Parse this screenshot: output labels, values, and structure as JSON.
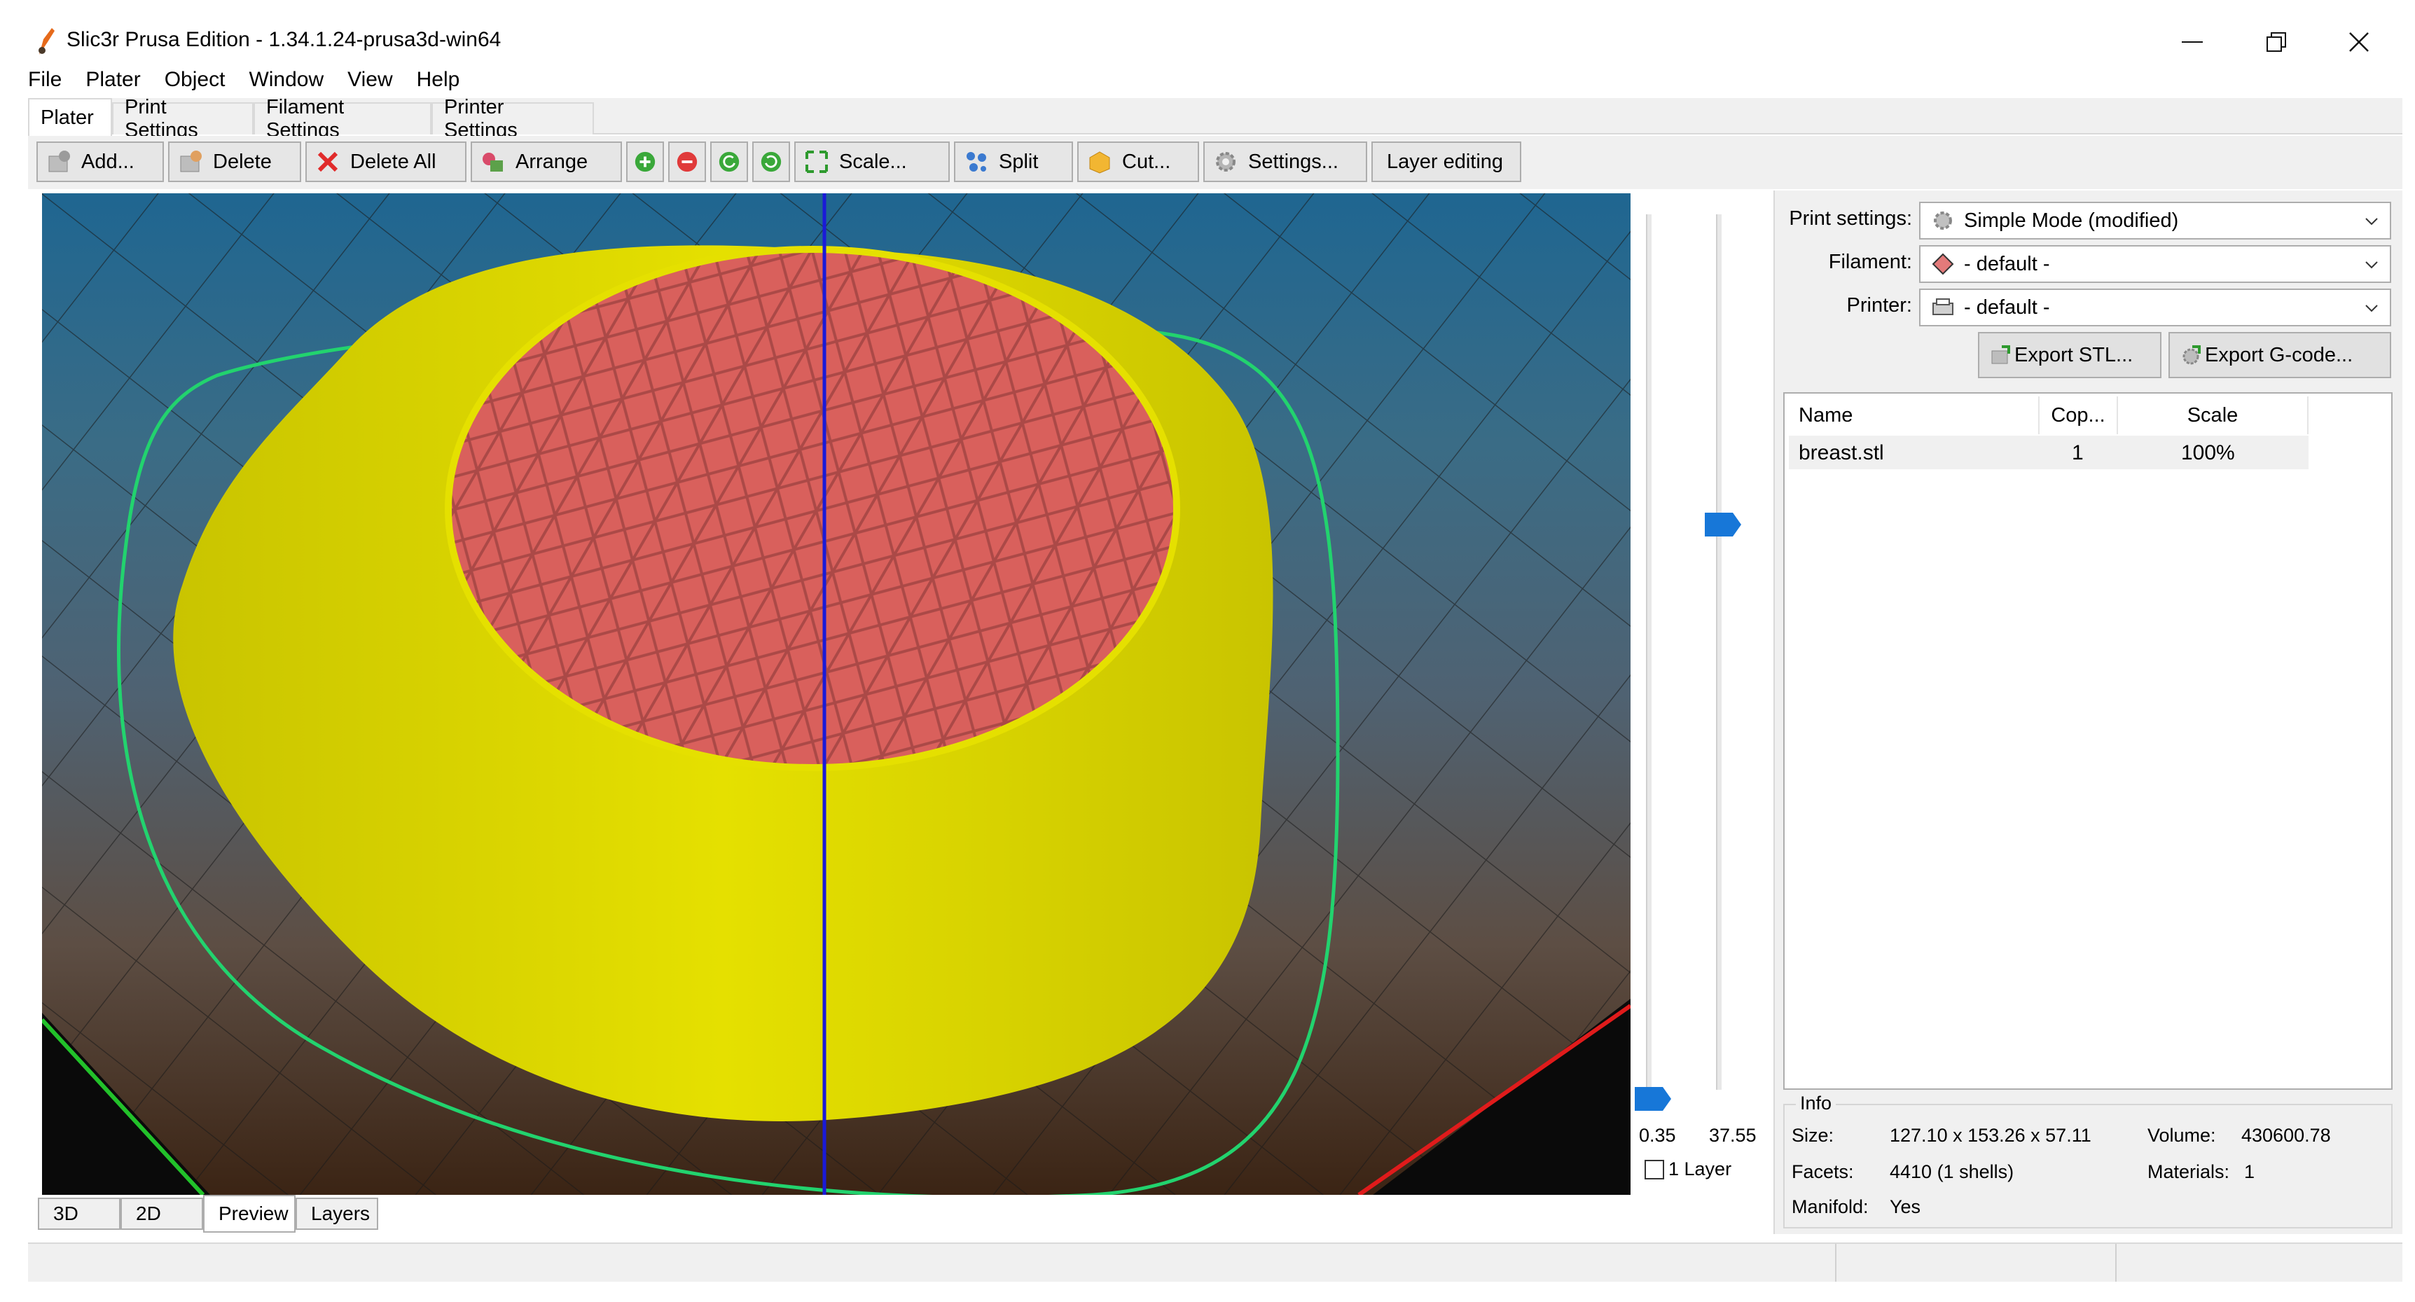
{
  "window": {
    "title": "Slic3r Prusa Edition - 1.34.1.24-prusa3d-win64",
    "controls": {
      "minimize_icon": "minimize-icon",
      "restore_icon": "restore-icon",
      "close_icon": "close-icon"
    }
  },
  "menu": [
    "File",
    "Plater",
    "Object",
    "Window",
    "View",
    "Help"
  ],
  "tabs": [
    "Plater",
    "Print Settings",
    "Filament Settings",
    "Printer Settings"
  ],
  "active_tab": "Plater",
  "toolbar": {
    "add": "Add...",
    "delete": "Delete",
    "delete_all": "Delete All",
    "arrange": "Arrange",
    "scale": "Scale...",
    "split": "Split",
    "cut": "Cut...",
    "settings": "Settings...",
    "layer_editing": "Layer editing"
  },
  "layer_slider": {
    "min_label": "0.35",
    "max_label": "37.55",
    "one_layer_label": "1 Layer",
    "one_layer_checked": false
  },
  "view_tabs": [
    "3D",
    "2D",
    "Preview",
    "Layers"
  ],
  "active_view_tab": "Preview",
  "right": {
    "print_settings_label": "Print settings:",
    "print_settings_value": "Simple Mode (modified)",
    "filament_label": "Filament:",
    "filament_value": "- default -",
    "printer_label": "Printer:",
    "printer_value": "- default -",
    "export_stl": "Export STL...",
    "export_gcode": "Export G-code..."
  },
  "object_list": {
    "headers": {
      "name": "Name",
      "copies": "Cop...",
      "scale": "Scale"
    },
    "rows": [
      {
        "name": "breast.stl",
        "copies": "1",
        "scale": "100%"
      }
    ]
  },
  "info": {
    "title": "Info",
    "size_label": "Size:",
    "size": "127.10 x 153.26 x 57.11",
    "volume_label": "Volume:",
    "volume": "430600.78",
    "facets_label": "Facets:",
    "facets": "4410 (1 shells)",
    "materials_label": "Materials:",
    "materials": "1",
    "manifold_label": "Manifold:",
    "manifold": "Yes"
  },
  "colors": {
    "perimeter_yellow": "#e5e000",
    "infill_red": "#d9605c",
    "skirt_green": "#22d36e",
    "axis_blue": "#1a1ad8",
    "slider_handle": "#1777d8"
  }
}
